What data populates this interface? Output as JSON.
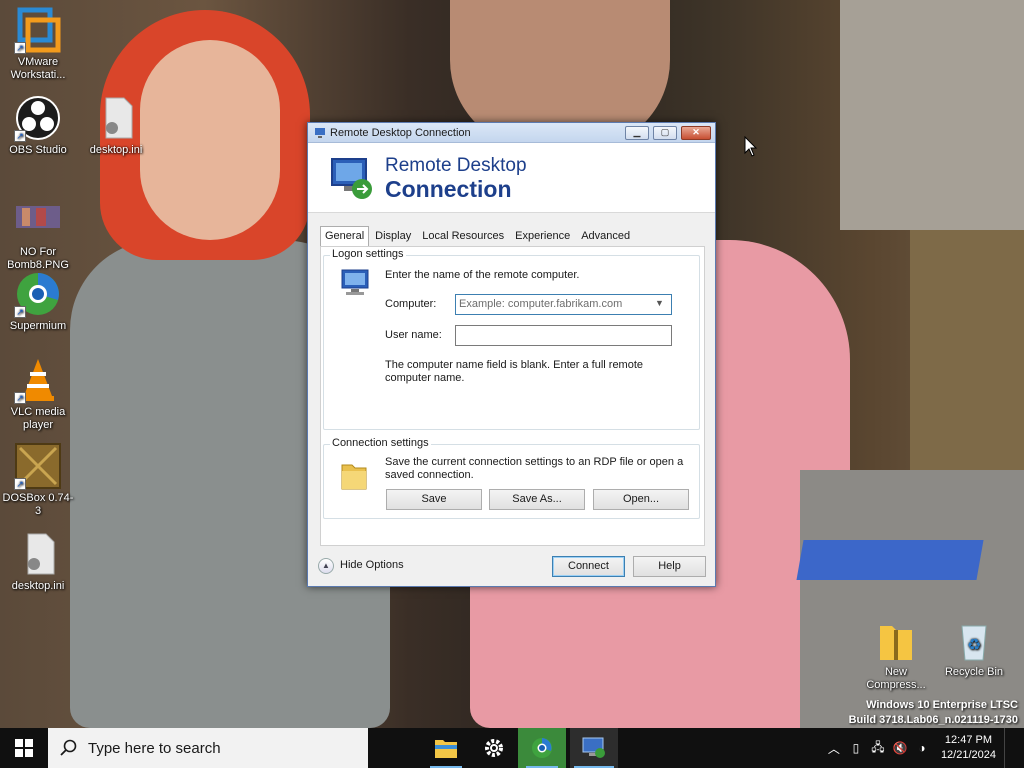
{
  "desktop": {
    "icons": [
      {
        "label": "VMware Workstati...",
        "icon": "vmware-icon"
      },
      {
        "label": "OBS Studio",
        "icon": "obs-icon"
      },
      {
        "label": "desktop.ini",
        "icon": "settings-file-icon"
      },
      {
        "label": "NO For Bomb8.PNG",
        "icon": "image-file-icon"
      },
      {
        "label": "Supermium",
        "icon": "supermium-icon"
      },
      {
        "label": "VLC media player",
        "icon": "vlc-icon"
      },
      {
        "label": "DOSBox 0.74-3",
        "icon": "dosbox-icon"
      },
      {
        "label": "desktop.ini",
        "icon": "settings-file-icon"
      },
      {
        "label": "New Compress...",
        "icon": "zip-folder-icon"
      },
      {
        "label": "Recycle Bin",
        "icon": "recycle-bin-icon"
      }
    ]
  },
  "dialog": {
    "title": "Remote Desktop Connection",
    "header_line1": "Remote Desktop",
    "header_line2": "Connection",
    "tabs": [
      "General",
      "Display",
      "Local Resources",
      "Experience",
      "Advanced"
    ],
    "active_tab": "General",
    "logon": {
      "group_title": "Logon settings",
      "instruction": "Enter the name of the remote computer.",
      "computer_label": "Computer:",
      "computer_value": "",
      "computer_placeholder": "Example: computer.fabrikam.com",
      "username_label": "User name:",
      "username_value": "",
      "warning": "The computer name field is blank. Enter a full remote computer name."
    },
    "connection": {
      "group_title": "Connection settings",
      "description": "Save the current connection settings to an RDP file or open a saved connection.",
      "save_label": "Save",
      "save_as_label": "Save As...",
      "open_label": "Open..."
    },
    "hide_options_label": "Hide Options",
    "connect_label": "Connect",
    "help_label": "Help"
  },
  "watermark": {
    "line1": "Windows 10 Enterprise LTSC",
    "line2": "Build 3718.Lab06_n.021119-1730"
  },
  "taskbar": {
    "search_placeholder": "Type here to search",
    "apps": [
      "file-explorer-icon",
      "settings-gear-icon",
      "supermium-icon",
      "remote-desktop-icon"
    ],
    "time": "12:47 PM",
    "date": "12/21/2024"
  }
}
